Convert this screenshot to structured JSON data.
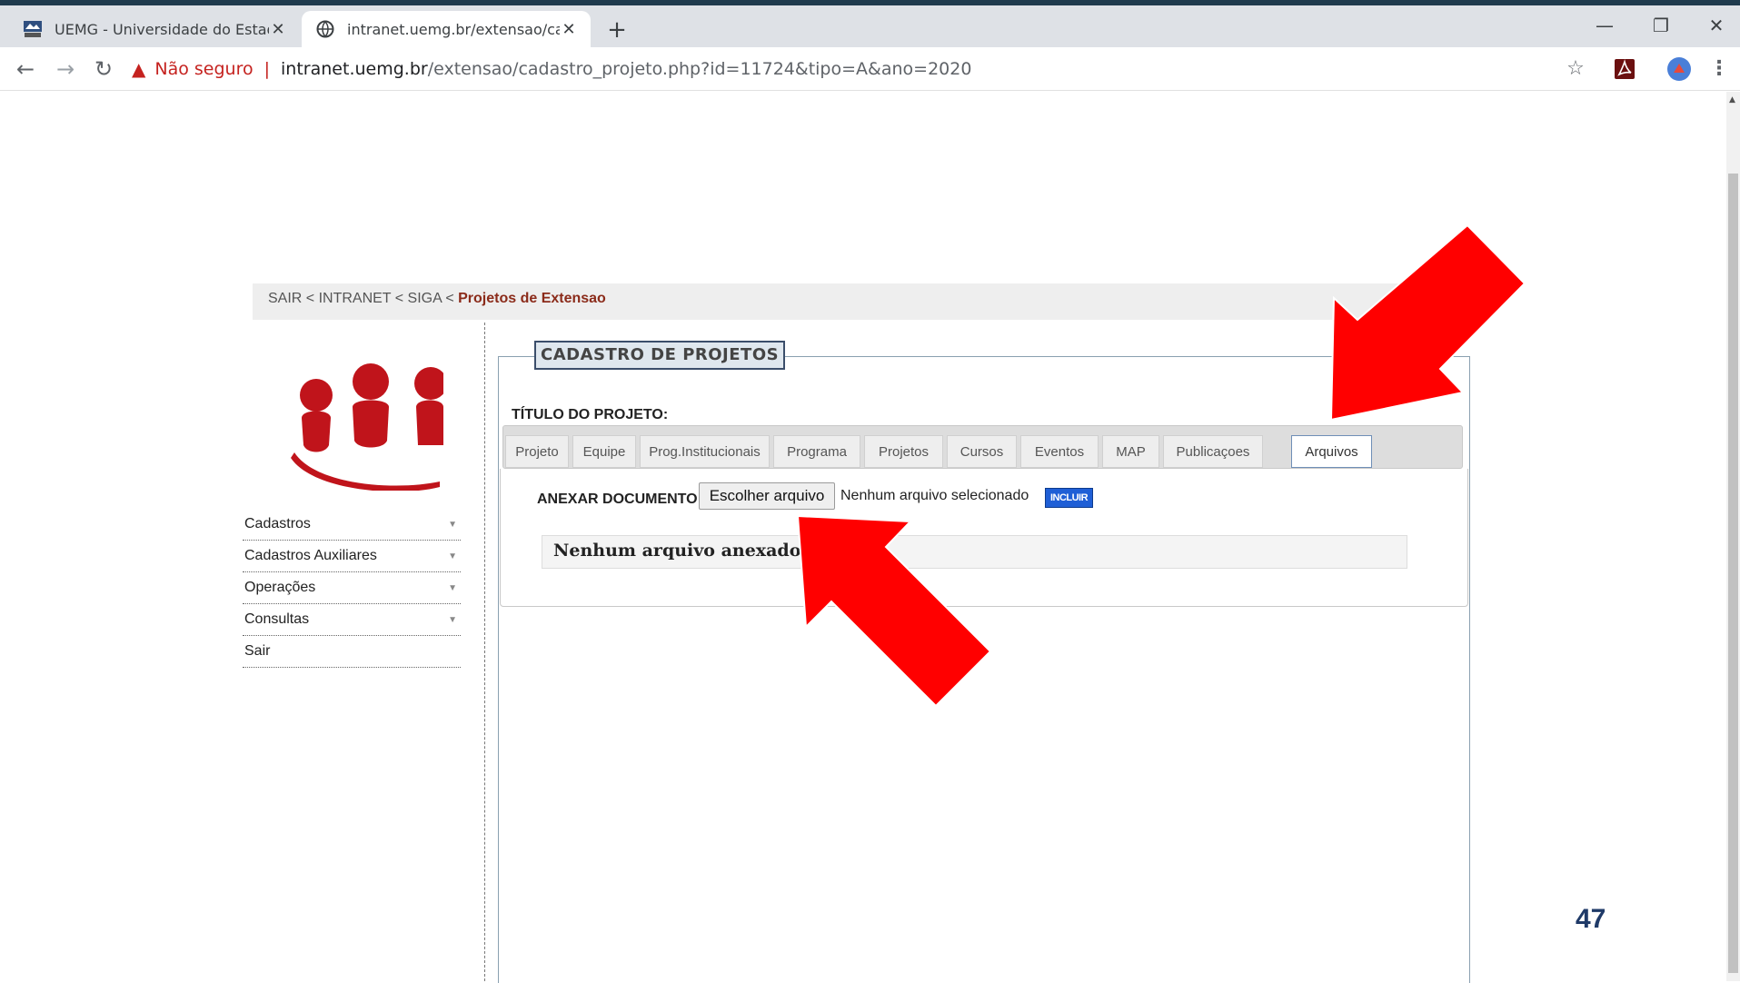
{
  "browser": {
    "tabs": [
      {
        "title": "UEMG - Universidade do Estado",
        "close": "✕"
      },
      {
        "title": "intranet.uemg.br/extensao/cadas",
        "close": "✕"
      }
    ],
    "new_tab": "+",
    "window_controls": {
      "minimize": "—",
      "restore": "❐",
      "close": "✕"
    },
    "nav": {
      "back": "←",
      "forward": "→",
      "reload": "↻"
    },
    "security_warning": "Não seguro",
    "separator": "|",
    "url_host": "intranet.uemg.br",
    "url_path": "/extensao/cadastro_projeto.php?id=11724&tipo=A&ano=2020",
    "toolbar_icons": [
      "star-icon",
      "pdf-extension-icon",
      "profile-avatar-icon",
      "more-menu-icon"
    ]
  },
  "breadcrumb": {
    "trail": "SAIR < INTRANET < SIGA < ",
    "current": "Projetos de Extensao"
  },
  "sidebar": {
    "items": [
      {
        "label": "Cadastros",
        "has_submenu": true
      },
      {
        "label": "Cadastros Auxiliares",
        "has_submenu": true
      },
      {
        "label": "Operações",
        "has_submenu": true
      },
      {
        "label": "Consultas",
        "has_submenu": true
      },
      {
        "label": "Sair",
        "has_submenu": false
      }
    ],
    "submenu_arrow": "▼"
  },
  "form": {
    "panel_title": "CADASTRO DE PROJETOS",
    "titulo_label": "TÍTULO DO PROJETO:",
    "tabs": [
      "Projeto",
      "Equipe",
      "Prog.Institucionais",
      "Programa",
      "Projetos",
      "Cursos",
      "Eventos",
      "MAP",
      "Publicaçoes",
      "Arquivos"
    ],
    "selected_tab": "Arquivos",
    "anexar_label": "ANEXAR DOCUMENTO:",
    "file_button": "Escolher arquivo",
    "file_status": "Nenhum arquivo selecionado",
    "incluir_button": "INCLUIR",
    "no_attachment_message": "Nenhum arquivo anexado!"
  },
  "slide_page_number": "47",
  "colors": {
    "accent_arrow": "#ff0000",
    "breadcrumb_current": "#8b2b1a",
    "incluir_bg": "#1f5fd6",
    "logo_red": "#c0141b",
    "page_number": "#1f3a68"
  }
}
